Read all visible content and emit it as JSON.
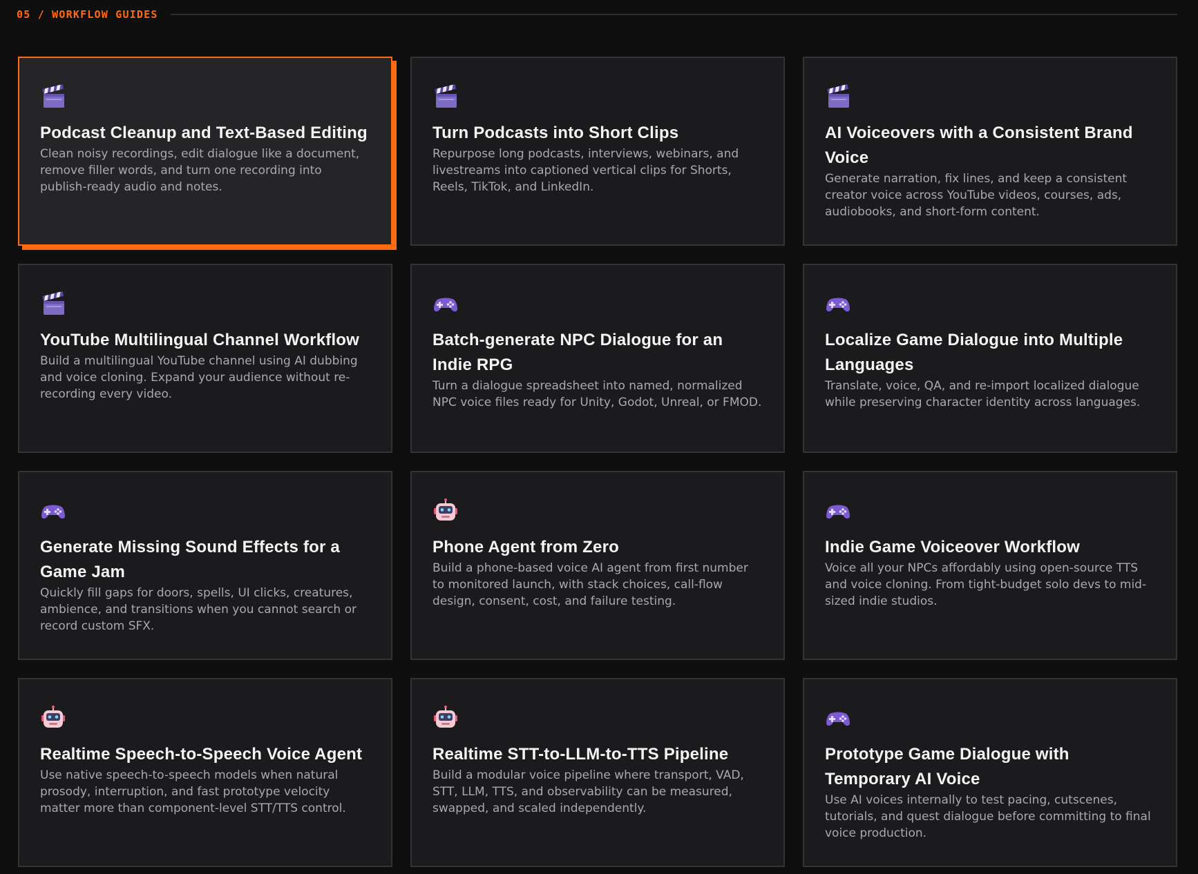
{
  "section": {
    "label": "05 / WORKFLOW GUIDES"
  },
  "colors": {
    "accent": "#ff6a13",
    "card_bg": "#1b1b1d",
    "card_border": "#333336",
    "title": "#f4f4f4",
    "description": "#a9a9ae"
  },
  "cards": [
    {
      "icon": "clapperboard-icon",
      "title": "Podcast Cleanup and Text-Based Editing",
      "description": "Clean noisy recordings, edit dialogue like a document, remove filler words, and turn one recording into publish-ready audio and notes."
    },
    {
      "icon": "clapperboard-icon",
      "title": "Turn Podcasts into Short Clips",
      "description": "Repurpose long podcasts, interviews, webinars, and livestreams into captioned vertical clips for Shorts, Reels, TikTok, and LinkedIn."
    },
    {
      "icon": "clapperboard-icon",
      "title": "AI Voiceovers with a Consistent Brand Voice",
      "description": "Generate narration, fix lines, and keep a consistent creator voice across YouTube videos, courses, ads, audiobooks, and short-form content."
    },
    {
      "icon": "clapperboard-icon",
      "title": "YouTube Multilingual Channel Workflow",
      "description": "Build a multilingual YouTube channel using AI dubbing and voice cloning. Expand your audience without re-recording every video."
    },
    {
      "icon": "gamepad-icon",
      "title": "Batch-generate NPC Dialogue for an Indie RPG",
      "description": "Turn a dialogue spreadsheet into named, normalized NPC voice files ready for Unity, Godot, Unreal, or FMOD."
    },
    {
      "icon": "gamepad-icon",
      "title": "Localize Game Dialogue into Multiple Languages",
      "description": "Translate, voice, QA, and re-import localized dialogue while preserving character identity across languages."
    },
    {
      "icon": "gamepad-icon",
      "title": "Generate Missing Sound Effects for a Game Jam",
      "description": "Quickly fill gaps for doors, spells, UI clicks, creatures, ambience, and transitions when you cannot search or record custom SFX."
    },
    {
      "icon": "robot-icon",
      "title": "Phone Agent from Zero",
      "description": "Build a phone-based voice AI agent from first number to monitored launch, with stack choices, call-flow design, consent, cost, and failure testing."
    },
    {
      "icon": "gamepad-icon",
      "title": "Indie Game Voiceover Workflow",
      "description": "Voice all your NPCs affordably using open-source TTS and voice cloning. From tight-budget solo devs to mid-sized indie studios."
    },
    {
      "icon": "robot-icon",
      "title": "Realtime Speech-to-Speech Voice Agent",
      "description": "Use native speech-to-speech models when natural prosody, interruption, and fast prototype velocity matter more than component-level STT/TTS control."
    },
    {
      "icon": "robot-icon",
      "title": "Realtime STT-to-LLM-to-TTS Pipeline",
      "description": "Build a modular voice pipeline where transport, VAD, STT, LLM, TTS, and observability can be measured, swapped, and scaled independently."
    },
    {
      "icon": "gamepad-icon",
      "title": "Prototype Game Dialogue with Temporary AI Voice",
      "description": "Use AI voices internally to test pacing, cutscenes, tutorials, and quest dialogue before committing to final voice production."
    }
  ]
}
